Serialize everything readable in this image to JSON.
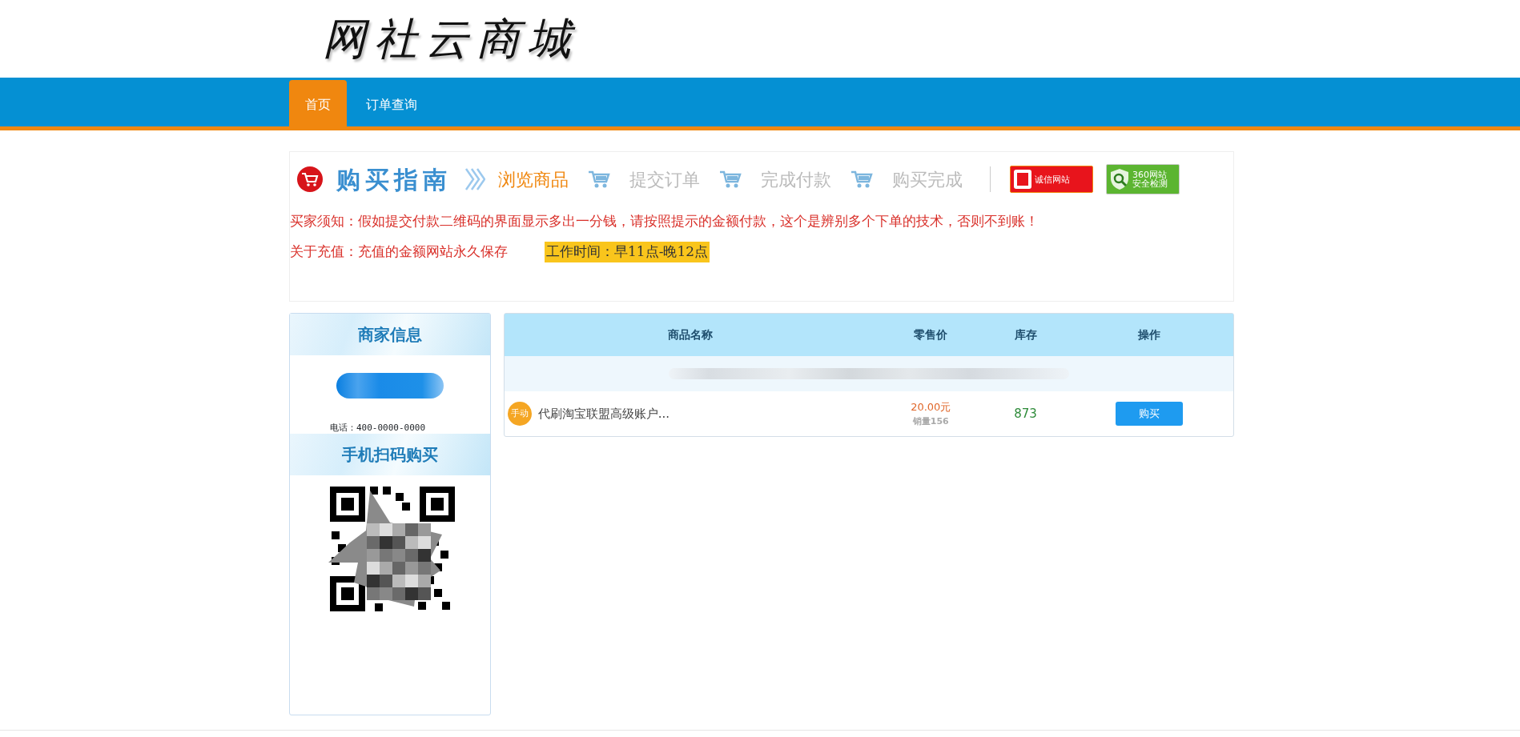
{
  "logo": {
    "text": "网社云商城"
  },
  "nav": [
    {
      "label": "首页",
      "selected": true
    },
    {
      "label": "订单查询",
      "selected": false
    }
  ],
  "guide": {
    "title": "购买指南",
    "steps": [
      {
        "label": "浏览商品",
        "selected": true
      },
      {
        "label": "提交订单",
        "selected": false
      },
      {
        "label": "完成付款",
        "selected": false
      },
      {
        "label": "购买完成",
        "selected": false
      }
    ],
    "badges": [
      {
        "kind": "trust",
        "lines": [
          "诚信网站"
        ]
      },
      {
        "kind": "security",
        "lines": [
          "360网站",
          "安全检测"
        ]
      }
    ]
  },
  "notices": [
    {
      "text": "买家须知：假如提交付款二维码的界面显示多出一分钱，请按照提示的金额付款，这个是辨别多个下单的技术，否则不到账！"
    },
    {
      "text": "关于充值：充值的金额网站永久保存",
      "highlight": "工作时间：早11点-晚12点"
    }
  ],
  "merchant": {
    "title": "商家信息",
    "phone": "电话：400-0000-0000"
  },
  "qr": {
    "title": "手机扫码购买"
  },
  "table": {
    "columns": [
      "商品名称",
      "零售价",
      "库存",
      "操作"
    ],
    "rows": [
      {
        "tag": "手动",
        "name": "代刷淘宝联盟高级账户...",
        "price": "20.00元",
        "sales": "销量156",
        "stock": "873",
        "action": "购买"
      }
    ]
  }
}
